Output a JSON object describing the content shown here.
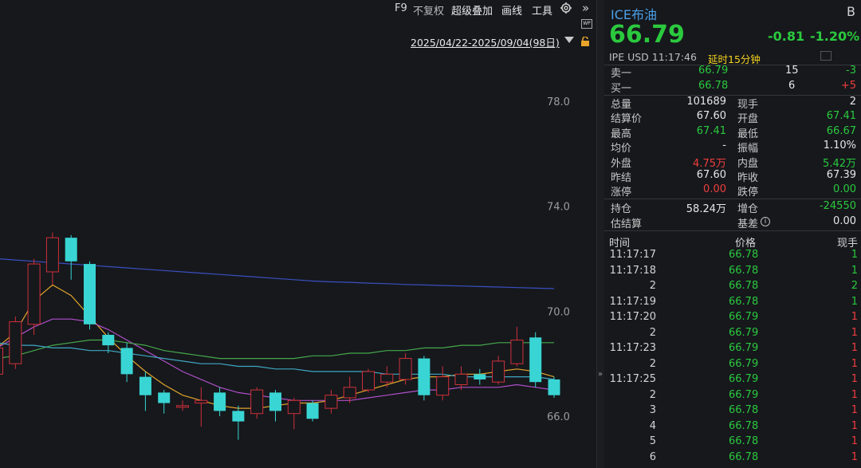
{
  "toolbar": {
    "f9": "F9",
    "fuquan": "不复权",
    "overlay": "超级叠加",
    "draw": "画线",
    "tools": "工具",
    "expand": "»",
    "wp": "WP"
  },
  "range": {
    "text": "2025/04/22-2025/09/04(98日)"
  },
  "chart_data": {
    "type": "candlestick",
    "y_ticks": [
      "78.0",
      "74.0",
      "70.0",
      "66.0"
    ],
    "ylim": [
      64.0,
      79.5
    ],
    "candles": [
      {
        "o": 67.6,
        "c": 68.6,
        "h": 68.9,
        "l": 67.4
      },
      {
        "o": 68.0,
        "c": 69.6,
        "h": 69.8,
        "l": 67.8
      },
      {
        "o": 69.5,
        "c": 71.8,
        "h": 72.0,
        "l": 69.1
      },
      {
        "o": 71.5,
        "c": 72.8,
        "h": 73.0,
        "l": 71.0
      },
      {
        "o": 72.8,
        "c": 71.9,
        "h": 72.9,
        "l": 71.2
      },
      {
        "o": 71.8,
        "c": 69.5,
        "h": 71.9,
        "l": 69.3
      },
      {
        "o": 69.1,
        "c": 68.7,
        "h": 69.2,
        "l": 68.4
      },
      {
        "o": 68.6,
        "c": 67.6,
        "h": 68.8,
        "l": 67.3
      },
      {
        "o": 67.5,
        "c": 66.8,
        "h": 67.7,
        "l": 66.2
      },
      {
        "o": 66.9,
        "c": 66.5,
        "h": 67.0,
        "l": 66.1
      },
      {
        "o": 66.4,
        "c": 66.4,
        "h": 66.6,
        "l": 66.2
      },
      {
        "o": 66.5,
        "c": 66.6,
        "h": 67.1,
        "l": 65.6
      },
      {
        "o": 66.9,
        "c": 66.2,
        "h": 67.1,
        "l": 66.0
      },
      {
        "o": 66.2,
        "c": 65.8,
        "h": 66.4,
        "l": 65.1
      },
      {
        "o": 66.1,
        "c": 67.0,
        "h": 67.1,
        "l": 65.9
      },
      {
        "o": 66.9,
        "c": 66.2,
        "h": 67.0,
        "l": 65.8
      },
      {
        "o": 66.1,
        "c": 66.6,
        "h": 66.7,
        "l": 65.5
      },
      {
        "o": 66.5,
        "c": 65.9,
        "h": 66.6,
        "l": 65.8
      },
      {
        "o": 66.3,
        "c": 66.8,
        "h": 67.0,
        "l": 66.1
      },
      {
        "o": 66.7,
        "c": 67.1,
        "h": 67.5,
        "l": 66.5
      },
      {
        "o": 67.0,
        "c": 67.7,
        "h": 67.8,
        "l": 66.9
      },
      {
        "o": 67.3,
        "c": 67.6,
        "h": 67.9,
        "l": 67.1
      },
      {
        "o": 67.4,
        "c": 68.2,
        "h": 68.4,
        "l": 67.2
      },
      {
        "o": 68.2,
        "c": 66.8,
        "h": 68.3,
        "l": 66.6
      },
      {
        "o": 66.8,
        "c": 67.5,
        "h": 67.9,
        "l": 66.6
      },
      {
        "o": 67.2,
        "c": 67.6,
        "h": 67.9,
        "l": 67.0
      },
      {
        "o": 67.6,
        "c": 67.4,
        "h": 67.8,
        "l": 67.2
      },
      {
        "o": 67.3,
        "c": 68.1,
        "h": 68.3,
        "l": 67.2
      },
      {
        "o": 68.0,
        "c": 68.9,
        "h": 69.4,
        "l": 67.9
      },
      {
        "o": 69.0,
        "c": 67.3,
        "h": 69.2,
        "l": 67.1
      },
      {
        "o": 67.4,
        "c": 66.8,
        "h": 67.5,
        "l": 66.7
      }
    ],
    "ma_lines": [
      {
        "color": "#e0a32a",
        "values": [
          68.6,
          69.2,
          70.4,
          71.0,
          70.6,
          69.8,
          69.0,
          68.3,
          67.7,
          67.2,
          66.8,
          66.6,
          66.4,
          66.3,
          66.3,
          66.4,
          66.5,
          66.5,
          66.6,
          66.8,
          67.0,
          67.2,
          67.4,
          67.5,
          67.5,
          67.6,
          67.6,
          67.7,
          67.8,
          67.7,
          67.5
        ]
      },
      {
        "color": "#b04fc8",
        "values": [
          68.6,
          69.0,
          69.4,
          69.7,
          69.7,
          69.6,
          69.3,
          68.9,
          68.5,
          68.1,
          67.7,
          67.4,
          67.1,
          66.9,
          66.8,
          66.7,
          66.6,
          66.6,
          66.6,
          66.6,
          66.7,
          66.8,
          66.9,
          67.0,
          67.0,
          67.1,
          67.1,
          67.1,
          67.2,
          67.1,
          67.0
        ]
      },
      {
        "color": "#46a84a",
        "values": [
          68.2,
          68.3,
          68.5,
          68.7,
          68.8,
          68.9,
          68.9,
          68.8,
          68.7,
          68.5,
          68.4,
          68.3,
          68.2,
          68.2,
          68.2,
          68.2,
          68.2,
          68.3,
          68.3,
          68.4,
          68.4,
          68.5,
          68.5,
          68.6,
          68.6,
          68.7,
          68.7,
          68.8,
          68.8,
          68.8,
          68.8
        ]
      },
      {
        "color": "#3fa7c2",
        "values": [
          68.8,
          68.7,
          68.7,
          68.6,
          68.6,
          68.5,
          68.5,
          68.4,
          68.3,
          68.2,
          68.1,
          68.0,
          68.0,
          67.9,
          67.9,
          67.8,
          67.8,
          67.7,
          67.7,
          67.7,
          67.7,
          67.6,
          67.6,
          67.6,
          67.6,
          67.5,
          67.5,
          67.5,
          67.5,
          67.5,
          67.4
        ]
      },
      {
        "color": "#3a50c0",
        "values": [
          72.0,
          71.95,
          71.9,
          71.85,
          71.8,
          71.75,
          71.7,
          71.65,
          71.6,
          71.55,
          71.5,
          71.45,
          71.4,
          71.35,
          71.3,
          71.25,
          71.2,
          71.15,
          71.12,
          71.1,
          71.07,
          71.05,
          71.02,
          71.0,
          70.98,
          70.96,
          70.94,
          70.92,
          70.9,
          70.88,
          70.86
        ]
      }
    ]
  },
  "panel": {
    "title": "ICE布油",
    "badge": "B",
    "price": "66.79",
    "change": "-0.81",
    "change_pct": "-1.20%",
    "exchange": "IPE  USD   11:17:46",
    "delay": "延时15分钟",
    "ask": {
      "label": "卖一",
      "price": "66.79",
      "qty": "15",
      "chg": "-3"
    },
    "bid": {
      "label": "买一",
      "price": "66.78",
      "qty": "6",
      "chg": "+5"
    },
    "stats": [
      {
        "l1": "总量",
        "v1": "101689",
        "c1": "w",
        "l2": "现手",
        "v2": "2",
        "c2": "w"
      },
      {
        "l1": "结算价",
        "v1": "67.60",
        "c1": "w",
        "l2": "开盘",
        "v2": "67.41",
        "c2": "g"
      },
      {
        "l1": "最高",
        "v1": "67.41",
        "c1": "g",
        "l2": "最低",
        "v2": "66.67",
        "c2": "g"
      },
      {
        "l1": "均价",
        "v1": "-",
        "c1": "w",
        "l2": "振幅",
        "v2": "1.10%",
        "c2": "w"
      },
      {
        "l1": "外盘",
        "v1": "4.75万",
        "c1": "r",
        "l2": "内盘",
        "v2": "5.42万",
        "c2": "g"
      },
      {
        "l1": "昨结",
        "v1": "67.60",
        "c1": "w",
        "l2": "昨收",
        "v2": "67.39",
        "c2": "w"
      },
      {
        "l1": "涨停",
        "v1": "0.00",
        "c1": "r",
        "l2": "跌停",
        "v2": "0.00",
        "c2": "g"
      }
    ],
    "stats2": [
      {
        "l1": "持仓",
        "v1": "58.24万",
        "c1": "w",
        "l2": "增仓",
        "v2": "-24550",
        "c2": "g"
      },
      {
        "l1": "估结算",
        "v1": "",
        "c1": "w",
        "l2": "基差",
        "v2": "0.00",
        "c2": "w"
      }
    ],
    "trade_header": {
      "time": "时间",
      "price": "价格",
      "vol": "现手"
    },
    "trades": [
      {
        "t": "11:17:17",
        "p": "66.78",
        "v": "1",
        "red": false
      },
      {
        "t": "11:17:18",
        "p": "66.78",
        "v": "1",
        "red": false
      },
      {
        "t": "2",
        "p": "66.78",
        "v": "2",
        "red": false
      },
      {
        "t": "11:17:19",
        "p": "66.78",
        "v": "1",
        "red": false
      },
      {
        "t": "11:17:20",
        "p": "66.79",
        "v": "1",
        "red": true
      },
      {
        "t": "2",
        "p": "66.79",
        "v": "1",
        "red": true
      },
      {
        "t": "11:17:23",
        "p": "66.79",
        "v": "1",
        "red": true
      },
      {
        "t": "2",
        "p": "66.79",
        "v": "1",
        "red": true
      },
      {
        "t": "11:17:25",
        "p": "66.79",
        "v": "1",
        "red": true
      },
      {
        "t": "2",
        "p": "66.79",
        "v": "1",
        "red": true
      },
      {
        "t": "3",
        "p": "66.78",
        "v": "1",
        "red": true
      },
      {
        "t": "4",
        "p": "66.78",
        "v": "1",
        "red": true
      },
      {
        "t": "5",
        "p": "66.78",
        "v": "1",
        "red": true
      },
      {
        "t": "6",
        "p": "66.78",
        "v": "1",
        "red": true
      }
    ]
  },
  "colors": {
    "up": "#d0303a",
    "down": "#39d5d4",
    "green": "#2bc93e",
    "red": "#f03d3d",
    "accent": "#4a9fe8"
  }
}
